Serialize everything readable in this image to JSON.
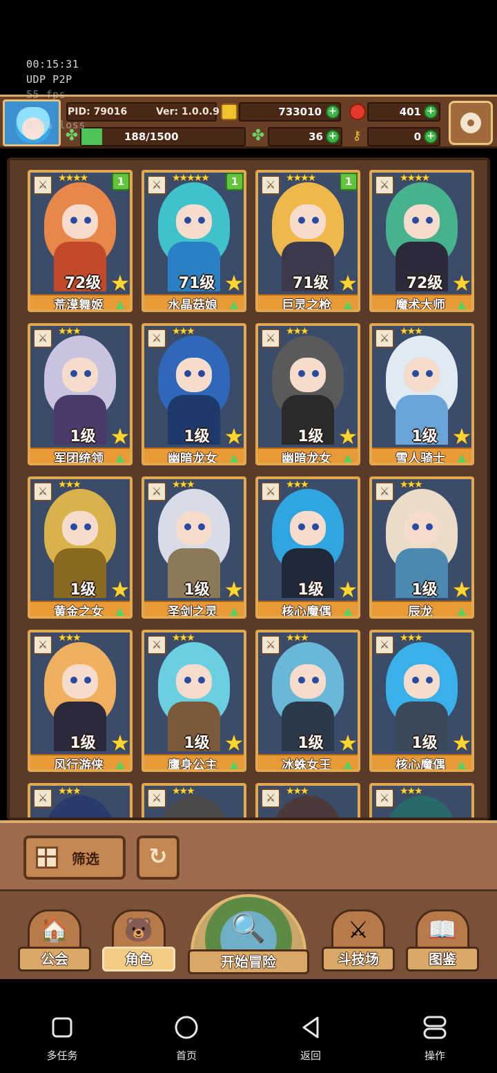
{
  "debug": {
    "time": "00:15:31",
    "protocol": "UDP P2P",
    "fps": "55 fps",
    "loss": "0.0% loss"
  },
  "topbar": {
    "pid_label": "PID: 79016",
    "version_label": "Ver: 1.0.0.9",
    "gold": "733010",
    "ruby": "401",
    "exp": "188/1500",
    "clover": "36",
    "key": "0",
    "exp_progress": 0.125
  },
  "heroes": [
    {
      "level": "72级",
      "name": "荒漠舞姬",
      "stars": "★★★★",
      "count": "1",
      "palette": [
        "#e8874a",
        "#c24a2a"
      ]
    },
    {
      "level": "71级",
      "name": "水晶菇娘",
      "stars": "★★★★★",
      "count": "1",
      "palette": [
        "#3fc2c9",
        "#2a80c2"
      ]
    },
    {
      "level": "71级",
      "name": "巨灵之枪",
      "stars": "★★★★",
      "count": "1",
      "palette": [
        "#f0b84a",
        "#3a3a4a"
      ]
    },
    {
      "level": "72级",
      "name": "魔术大师",
      "stars": "★★★★",
      "count": "",
      "palette": [
        "#48b28c",
        "#2a2a3a"
      ]
    },
    {
      "level": "1级",
      "name": "军团统领",
      "stars": "★★★",
      "count": "",
      "palette": [
        "#c9c3df",
        "#4a3a6a"
      ]
    },
    {
      "level": "1级",
      "name": "幽暗龙女",
      "stars": "★★★",
      "count": "",
      "palette": [
        "#2f68b8",
        "#1e3a6a"
      ]
    },
    {
      "level": "1级",
      "name": "幽暗龙女",
      "stars": "★★★",
      "count": "",
      "palette": [
        "#5a5a5a",
        "#2a2a2a"
      ]
    },
    {
      "level": "1级",
      "name": "雪人骑士",
      "stars": "★★★",
      "count": "",
      "palette": [
        "#e0eaf5",
        "#6aa4d8"
      ]
    },
    {
      "level": "1级",
      "name": "黄金之女",
      "stars": "★★★",
      "count": "",
      "palette": [
        "#d8b24a",
        "#8a6a20"
      ]
    },
    {
      "level": "1级",
      "name": "圣剑之灵",
      "stars": "★★★",
      "count": "",
      "palette": [
        "#d8dce8",
        "#8a7a5a"
      ]
    },
    {
      "level": "1级",
      "name": "核心魔偶",
      "stars": "★★★",
      "count": "",
      "palette": [
        "#2fa6e0",
        "#1e2a3a"
      ]
    },
    {
      "level": "1级",
      "name": "辰龙",
      "stars": "★★★",
      "count": "",
      "palette": [
        "#eadcc8",
        "#4a8ab0"
      ]
    },
    {
      "level": "1级",
      "name": "风行游侠",
      "stars": "★★★",
      "count": "",
      "palette": [
        "#f0b060",
        "#2a2a3a"
      ]
    },
    {
      "level": "1级",
      "name": "鹰身公主",
      "stars": "★★★",
      "count": "",
      "palette": [
        "#6ad0e0",
        "#7a5a3a"
      ]
    },
    {
      "level": "1级",
      "name": "冰蛛女王",
      "stars": "★★★",
      "count": "",
      "palette": [
        "#6ab8d8",
        "#2a3a4a"
      ]
    },
    {
      "level": "1级",
      "name": "核心魔偶",
      "stars": "★★★",
      "count": "",
      "palette": [
        "#3ab0e8",
        "#3a4a5a"
      ]
    },
    {
      "level": "",
      "name": "",
      "stars": "★★★",
      "count": "",
      "palette": [
        "#2a3a6a",
        "#2a2a3a"
      ]
    },
    {
      "level": "",
      "name": "",
      "stars": "★★★",
      "count": "",
      "palette": [
        "#4a4a4a",
        "#2a2a2a"
      ]
    },
    {
      "level": "",
      "name": "",
      "stars": "★★★",
      "count": "",
      "palette": [
        "#4a3a3a",
        "#2a2a2a"
      ]
    },
    {
      "level": "",
      "name": "",
      "stars": "★★★",
      "count": "",
      "palette": [
        "#2a6a6a",
        "#2a2a3a"
      ]
    }
  ],
  "filter": {
    "label": "筛选"
  },
  "nav": {
    "guild": "公会",
    "character": "角色",
    "adventure": "开始冒险",
    "arena": "斗技场",
    "codex": "图鉴"
  },
  "system_nav": {
    "multitask": "多任务",
    "home": "首页",
    "back": "返回",
    "operate": "操作"
  },
  "colors": {
    "frame_gold": "#e3a94e",
    "panel_brown": "#5a3a28",
    "accent_green": "#3fb548"
  }
}
